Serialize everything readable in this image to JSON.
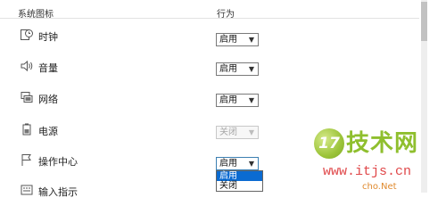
{
  "header": {
    "system_icons": "系统图标",
    "behavior": "行为"
  },
  "rows": [
    {
      "label": "时钟",
      "icon": "clock-icon",
      "value": "启用"
    },
    {
      "label": "音量",
      "icon": "volume-icon",
      "value": "启用"
    },
    {
      "label": "网络",
      "icon": "network-icon",
      "value": "启用"
    },
    {
      "label": "电源",
      "icon": "power-icon",
      "value": "关闭"
    },
    {
      "label": "操作中心",
      "icon": "action-center-flag-icon",
      "value": "启用"
    },
    {
      "label": "输入指示",
      "icon": "input-indicator-icon"
    }
  ],
  "dropdown": {
    "options": [
      "启用",
      "关闭"
    ]
  },
  "watermark": {
    "brand": "技术网",
    "url": "www.itjs.cn",
    "tag": "cho",
    "suffix": ".Net"
  }
}
